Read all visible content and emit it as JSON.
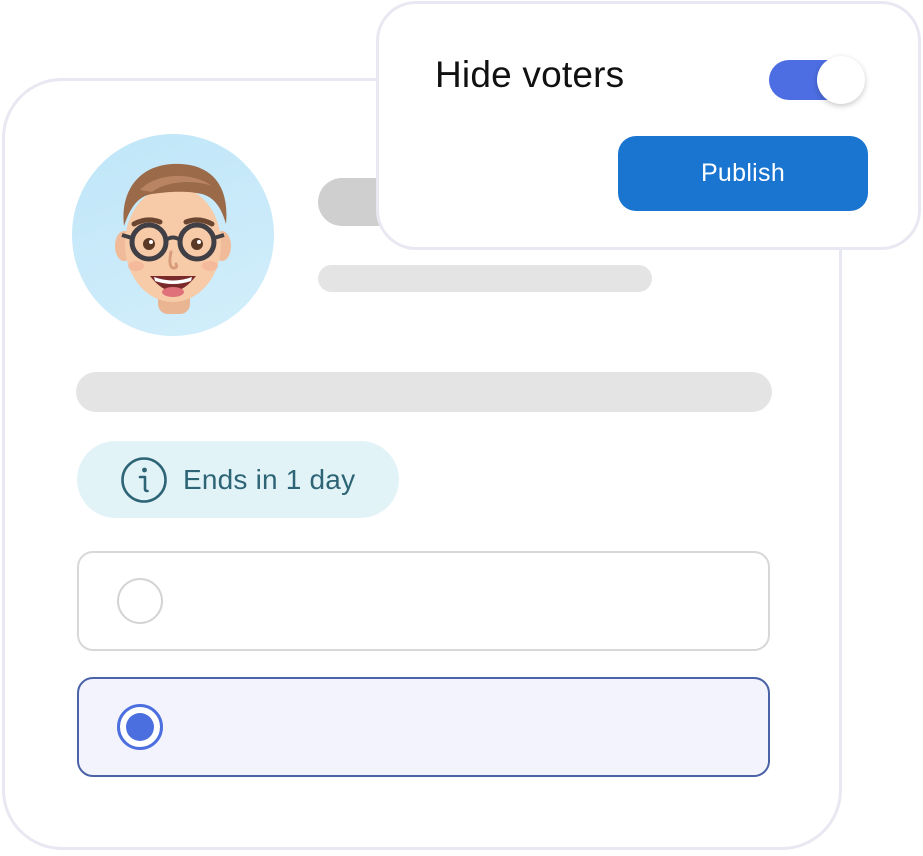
{
  "popover": {
    "hide_voters_label": "Hide voters",
    "hide_voters_enabled": true,
    "publish_label": "Publish"
  },
  "poll": {
    "deadline_text": "Ends in 1 day",
    "options": [
      {
        "selected": false
      },
      {
        "selected": true
      }
    ]
  },
  "icons": {
    "avatar": "memoji-avatar",
    "deadline": "info-icon"
  },
  "colors": {
    "accent": "#4c6fe0",
    "publish": "#1a75d1",
    "deadline_bg": "#e2f3f7",
    "deadline_text": "#2d6576",
    "avatar_bg": "#c8eaf9",
    "selected_option_bg": "#f2f3fd",
    "selected_option_border": "#4a62a6"
  }
}
